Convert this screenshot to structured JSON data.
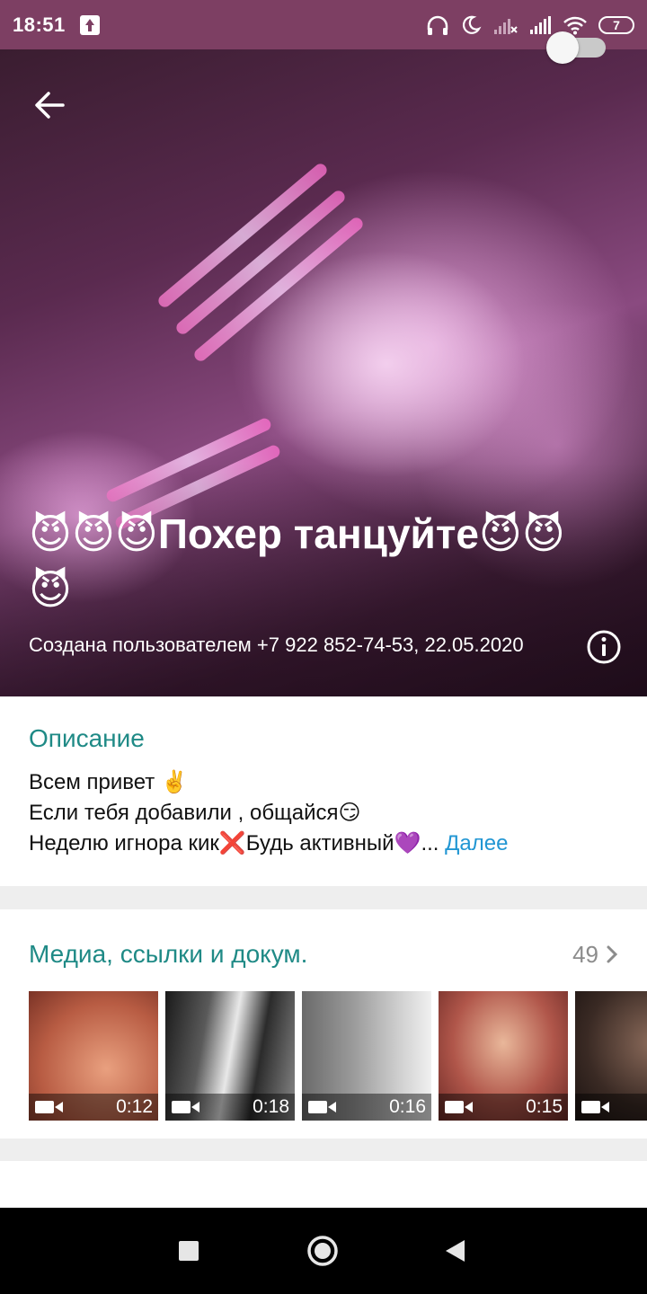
{
  "status_bar": {
    "time": "18:51",
    "battery": "7",
    "icons": [
      "upload-notification-icon",
      "headphones-icon",
      "moon-icon",
      "signal-no-service-icon",
      "signal-icon",
      "wifi-icon",
      "battery-icon"
    ]
  },
  "header": {
    "title": "😈😈😈Похер танцуйте😈😈😈",
    "subtitle": "Создана пользователем +7 922 852-74-53, 22.05.2020",
    "back_icon": "arrow-left-icon",
    "info_icon": "info-icon"
  },
  "description": {
    "title": "Описание",
    "line1": "Всем привет ✌️",
    "line2": "Если тебя добавили , общайся😏",
    "line3": "Неделю игнора кик❌Будь активный💜...",
    "more": "Далее"
  },
  "media": {
    "title": "Медиа, ссылки и докум.",
    "count": "49",
    "items": [
      {
        "duration": "0:12"
      },
      {
        "duration": "0:18"
      },
      {
        "duration": "0:16"
      },
      {
        "duration": "0:15"
      },
      {
        "duration": ""
      }
    ]
  },
  "colors": {
    "status_bar": "#7d3f63",
    "accent_teal": "#1f8a86",
    "link_blue": "#2196d3"
  }
}
